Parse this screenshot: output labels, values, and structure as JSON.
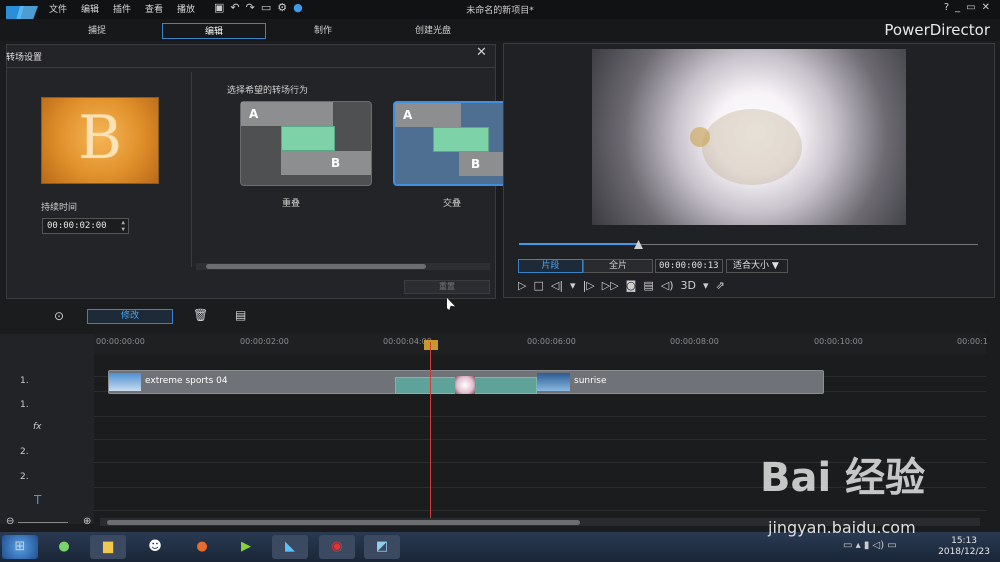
{
  "menu": [
    "文件",
    "编辑",
    "插件",
    "查看",
    "播放"
  ],
  "window": {
    "title": "未命名的新项目*",
    "controls": [
      "?",
      "_",
      "▭",
      "✕"
    ]
  },
  "tabs": [
    "捕捉",
    "编辑",
    "制作",
    "创建光盘"
  ],
  "brand": "PowerDirector",
  "transition_panel": {
    "title": "转场设置",
    "close": "✕",
    "thumb_letter": "B",
    "duration_label": "持续时间",
    "duration_value": "00:00:02:00",
    "behavior_label": "选择希望的转场行为",
    "options": [
      {
        "label": "重叠",
        "a": "A",
        "b": "B",
        "selected": false
      },
      {
        "label": "交叠",
        "a": "A",
        "b": "B",
        "selected": true
      }
    ],
    "reset": "重置"
  },
  "preview": {
    "seg": "片段",
    "full": "全片",
    "timecode": "00:00:00:13",
    "fit": "适合大小",
    "mode_3d": "3D",
    "progress": 0.26
  },
  "timeline_toolbar": {
    "modify": "修改"
  },
  "ruler": [
    "00:00:00:00",
    "00:00:02:00",
    "00:00:04:00",
    "00:00:06:00",
    "00:00:08:00",
    "00:00:10:00",
    "00:00:1"
  ],
  "tracks": [
    {
      "label": "",
      "icon": "square-icon"
    },
    {
      "label": "1.",
      "icon": "video-track-icon"
    },
    {
      "label": "1.",
      "icon": "audio-track-icon"
    },
    {
      "label": "fx",
      "icon": "fx-icon"
    },
    {
      "label": "2.",
      "icon": "video-track-icon"
    },
    {
      "label": "2.",
      "icon": "audio-track-icon"
    },
    {
      "label": "T",
      "icon": "title-track-icon"
    }
  ],
  "clips": {
    "first": "extreme sports 04",
    "second": "sunrise"
  },
  "taskbar": {
    "time": "15:13",
    "date": "2018/12/23"
  },
  "watermark": {
    "brand": "Bai 经验",
    "url": "jingyan.baidu.com"
  }
}
